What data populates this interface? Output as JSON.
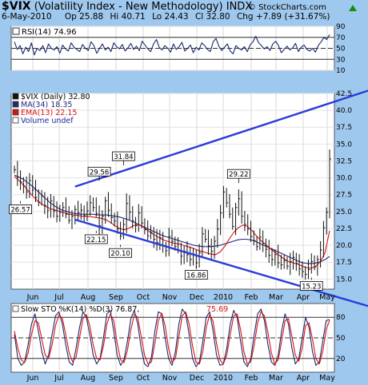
{
  "header": {
    "symbol": "$VIX",
    "name": "(Volatility Index - New Methodology)",
    "exchange": "INDX",
    "date": "6-May-2010",
    "open": "Op 25.88",
    "high": "Hi 40.71",
    "low": "Lo 24.43",
    "close": "Cl 32.80",
    "change": "Chg +7.89 (+31.67%)",
    "change_arrow": "up-arrow",
    "brand": "© StockCharts.com"
  },
  "colors": {
    "background": "#9fc8ee",
    "panel": "#ffffff",
    "trendline": "#2a3bd8",
    "ma34": "#1f2a80",
    "ema13": "#dd1111",
    "price_bar": "#111111",
    "rsi_line": "#1a2a6a",
    "sto_k": "#1a2a6a",
    "sto_d": "#dd1111",
    "up_arrow": "#109010"
  },
  "x_axis": {
    "labels": [
      "Jun",
      "Jul",
      "Aug",
      "Sep",
      "Oct",
      "Nov",
      "Dec",
      "2010",
      "Feb",
      "Mar",
      "Apr",
      "May"
    ]
  },
  "chart_data": [
    {
      "type": "line",
      "panel": "rsi",
      "legend": "RSI(14) 74.96",
      "ylim": [
        10,
        90
      ],
      "yticks": [
        90,
        70,
        50,
        30,
        10
      ],
      "reference_lines": [
        70,
        50,
        30
      ],
      "series": [
        {
          "name": "RSI(14)",
          "values": [
            62,
            48,
            55,
            40,
            52,
            44,
            60,
            38,
            50,
            46,
            55,
            42,
            58,
            50,
            47,
            53,
            41,
            56,
            49,
            45,
            60,
            52,
            48,
            44,
            57,
            50,
            46,
            62,
            55,
            41,
            50,
            58,
            47,
            52,
            44,
            60,
            53,
            49,
            57,
            45,
            51,
            59,
            48,
            54,
            46,
            63,
            56,
            49,
            44,
            58,
            66,
            52,
            47,
            55,
            50,
            43,
            58,
            48,
            53,
            61,
            45,
            50,
            56,
            42,
            52,
            47,
            60,
            55,
            48,
            44,
            62,
            68,
            54,
            46,
            52,
            58,
            45,
            40,
            55,
            50,
            47,
            53,
            44,
            56,
            62,
            72,
            60,
            55,
            49,
            53,
            46,
            58,
            63,
            55,
            42,
            48,
            54,
            47,
            51,
            59,
            44,
            52,
            56,
            48,
            45,
            50,
            43,
            55,
            62,
            70,
            66,
            74.96
          ]
        }
      ]
    },
    {
      "type": "bar",
      "panel": "price",
      "legend": [
        "$VIX (Daily) 32.80",
        "MA(34) 18.35",
        "EMA(13) 22.15",
        "Volume undef"
      ],
      "ylim": [
        13.5,
        42.5
      ],
      "yticks": [
        42.5,
        40.0,
        37.5,
        35.0,
        32.5,
        30.0,
        27.5,
        25.0,
        22.5,
        20.0,
        17.5,
        15.0
      ],
      "annotations": [
        {
          "label": "26.57",
          "x": 2,
          "y": 26.57
        },
        {
          "label": "29.56",
          "x": 28,
          "y": 29.56
        },
        {
          "label": "31.84",
          "x": 36,
          "y": 31.84
        },
        {
          "label": "22.15",
          "x": 27,
          "y": 22.15
        },
        {
          "label": "20.10",
          "x": 35,
          "y": 20.1
        },
        {
          "label": "16.86",
          "x": 60,
          "y": 16.86
        },
        {
          "label": "29.22",
          "x": 74,
          "y": 29.22
        },
        {
          "label": "15.23",
          "x": 98,
          "y": 15.23
        }
      ],
      "trendlines": [
        {
          "from": [
            20,
            28.7
          ],
          "to": [
            112,
            42.2
          ]
        },
        {
          "from": [
            20,
            23.8
          ],
          "to": [
            112,
            13.6
          ]
        }
      ],
      "series": [
        {
          "name": "$VIX (Daily)",
          "values": [
            31.2,
            30.1,
            29.4,
            28.8,
            27.9,
            29.6,
            28.2,
            27.1,
            26.4,
            27.3,
            25.9,
            25.2,
            26.6,
            25.1,
            24.3,
            24.9,
            25.6,
            24.6,
            23.7,
            24.3,
            25.3,
            24.8,
            25.2,
            24.4,
            25.1,
            26.3,
            25.6,
            24.7,
            22.9,
            24.3,
            26.6,
            25.2,
            24.1,
            23.6,
            22.4,
            21.4,
            23.1,
            26.2,
            24.9,
            23.6,
            22.9,
            24.8,
            23.3,
            22.3,
            21.4,
            21.9,
            20.9,
            20.4,
            21.1,
            19.9,
            19.2,
            21.3,
            20.6,
            19.8,
            19.3,
            18.4,
            19.1,
            18.6,
            17.9,
            18.7,
            17.4,
            18.9,
            21.7,
            20.9,
            19.9,
            19.1,
            20.6,
            22.4,
            24.8,
            27.9,
            26.3,
            24.6,
            22.8,
            25.6,
            26.9,
            24.3,
            23.1,
            22.4,
            21.3,
            20.7,
            19.8,
            21.2,
            20.3,
            19.4,
            18.5,
            17.9,
            18.6,
            17.4,
            17.1,
            17.7,
            16.9,
            17.6,
            18.2,
            17.3,
            16.5,
            16.1,
            15.7,
            16.4,
            17.6,
            16.8,
            17.9,
            19.3,
            22.6,
            24.9,
            32.8
          ]
        },
        {
          "name": "MA(34)",
          "values": [
            30.4,
            30.1,
            29.8,
            29.3,
            28.8,
            28.2,
            27.6,
            27.0,
            26.4,
            25.9,
            25.5,
            25.2,
            25.0,
            24.8,
            24.7,
            24.6,
            24.6,
            24.6,
            24.6,
            24.5,
            24.5,
            24.5,
            24.4,
            24.3,
            24.2,
            24.0,
            23.8,
            23.5,
            23.2,
            22.9,
            22.6,
            22.3,
            22.0,
            21.7,
            21.4,
            21.2,
            21.0,
            20.8,
            20.6,
            20.4,
            20.2,
            20.0,
            19.9,
            19.8,
            19.8,
            19.8,
            19.9,
            20.0,
            20.2,
            20.4,
            20.6,
            20.8,
            20.9,
            20.9,
            20.8,
            20.6,
            20.3,
            20.0,
            19.7,
            19.4,
            19.1,
            18.8,
            18.5,
            18.2,
            17.9,
            17.6,
            17.4,
            17.3,
            17.3,
            17.4,
            17.6,
            17.9,
            18.35
          ]
        },
        {
          "name": "EMA(13)",
          "values": [
            30.2,
            29.6,
            28.9,
            28.1,
            27.3,
            26.6,
            26.1,
            25.7,
            25.4,
            25.2,
            25.0,
            24.8,
            24.6,
            24.5,
            24.4,
            24.3,
            24.3,
            24.2,
            24.1,
            24.0,
            23.8,
            23.4,
            22.9,
            22.5,
            22.3,
            22.5,
            22.9,
            23.1,
            22.8,
            22.3,
            21.8,
            21.4,
            21.0,
            20.7,
            20.5,
            20.3,
            20.2,
            20.0,
            19.8,
            19.6,
            19.3,
            19.1,
            18.9,
            18.7,
            18.6,
            19.0,
            19.8,
            20.9,
            21.9,
            22.6,
            23.0,
            22.8,
            22.2,
            21.4,
            20.7,
            20.1,
            19.5,
            19.0,
            18.5,
            18.0,
            17.6,
            17.4,
            17.2,
            16.9,
            16.7,
            16.6,
            16.9,
            17.6,
            18.9,
            22.15
          ]
        }
      ]
    },
    {
      "type": "line",
      "panel": "stochastic",
      "legend": [
        "Slow STO %K(14) %D(3) 76.87,",
        "75.69"
      ],
      "ylim": [
        0,
        100
      ],
      "yticks": [
        80,
        50,
        20
      ],
      "reference_lines": [
        80,
        50,
        20
      ],
      "series": [
        {
          "name": "%K(14)",
          "values": [
            55,
            20,
            10,
            15,
            40,
            70,
            85,
            60,
            30,
            12,
            25,
            55,
            82,
            88,
            70,
            40,
            15,
            10,
            35,
            65,
            88,
            80,
            55,
            25,
            12,
            20,
            50,
            85,
            90,
            60,
            25,
            10,
            18,
            45,
            78,
            90,
            70,
            35,
            12,
            8,
            22,
            60,
            88,
            85,
            50,
            20,
            10,
            30,
            70,
            92,
            85,
            55,
            20,
            8,
            15,
            45,
            80,
            88,
            60,
            25,
            10,
            12,
            35,
            70,
            90,
            80,
            45,
            15,
            8,
            20,
            55,
            85,
            92,
            75,
            40,
            15,
            10,
            25,
            60,
            85,
            70,
            35,
            12,
            20,
            50,
            80,
            65,
            30,
            10,
            15,
            45,
            75,
            76.87
          ]
        },
        {
          "name": "%D(3)",
          "values": [
            60,
            35,
            18,
            14,
            28,
            55,
            75,
            72,
            48,
            25,
            20,
            40,
            68,
            84,
            78,
            55,
            28,
            15,
            22,
            50,
            78,
            84,
            68,
            40,
            20,
            18,
            38,
            70,
            85,
            75,
            42,
            18,
            14,
            32,
            62,
            84,
            80,
            52,
            25,
            12,
            15,
            42,
            75,
            86,
            68,
            35,
            15,
            20,
            52,
            82,
            88,
            70,
            38,
            15,
            12,
            30,
            65,
            84,
            74,
            42,
            18,
            12,
            25,
            55,
            82,
            85,
            62,
            30,
            12,
            15,
            40,
            72,
            88,
            82,
            58,
            28,
            12,
            18,
            45,
            75,
            78,
            52,
            25,
            16,
            35,
            68,
            72,
            48,
            20,
            12,
            30,
            62,
            75.69
          ]
        }
      ]
    }
  ]
}
